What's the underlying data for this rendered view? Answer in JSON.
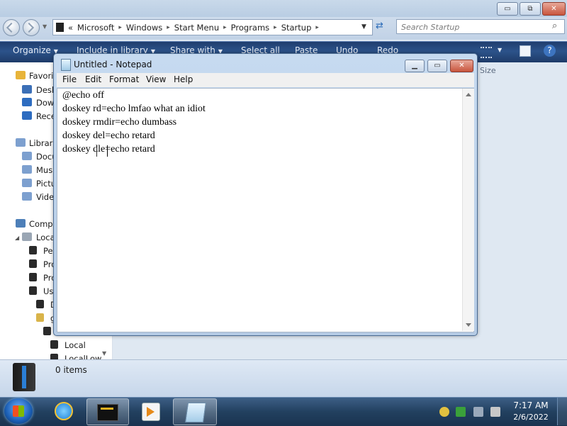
{
  "explorer": {
    "caption_minimize": "▭",
    "caption_maximize": "⧉",
    "caption_close": "✕",
    "address": {
      "overflow": "«",
      "segments": [
        "Microsoft",
        "Windows",
        "Start Menu",
        "Programs",
        "Startup"
      ],
      "separator": "▸"
    },
    "search_placeholder": "Search Startup",
    "toolbar": [
      "Organize",
      "Include in library",
      "Share with",
      "Select all",
      "Paste",
      "Undo",
      "Redo"
    ],
    "column_header": "Size",
    "nav_items": {
      "favorites": "Favorit",
      "desktop": "Desk",
      "downloads": "Dow",
      "recent": "Rece",
      "libraries": "Librari",
      "documents": "Docu",
      "music": "Musi",
      "pictures": "Pictu",
      "videos": "Vide",
      "computer": "Compu",
      "local_disk": "Loca",
      "perflogs": "Per",
      "program_files": "Pro",
      "program_files_x86": "Pro",
      "users": "Us",
      "d": "D",
      "g": "g",
      "local": "Local",
      "locallow": "LocalLow"
    },
    "status": {
      "items": "0 items"
    }
  },
  "notepad": {
    "title": "Untitled - Notepad",
    "menu": [
      "File",
      "Edit",
      "Format",
      "View",
      "Help"
    ],
    "lines": [
      "@echo off",
      "doskey rd=echo lmfao what an idiot",
      "doskey rmdir=echo dumbass",
      "doskey del=echo retard",
      "doskey dle=echo retard"
    ]
  },
  "taskbar": {
    "clock_time": "7:17 AM",
    "clock_date": "2/6/2022"
  },
  "colors": {
    "toolbar_bg": "#2c538a",
    "taskbar_bg": "#22405f",
    "close_red": "#c8553d"
  }
}
